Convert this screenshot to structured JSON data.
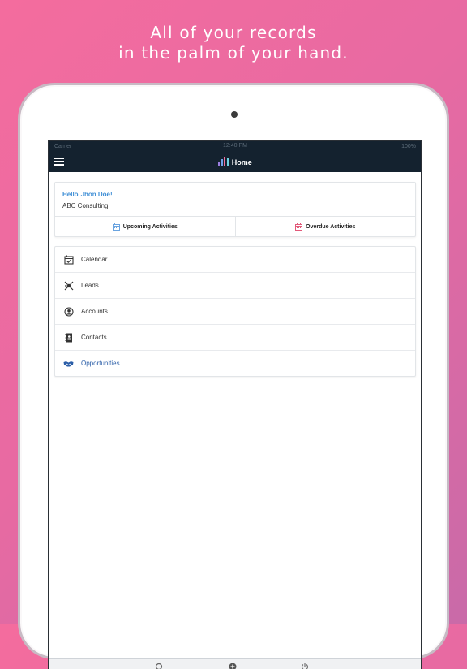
{
  "promo": {
    "line1": "All of your records",
    "line2": "in the palm of your hand."
  },
  "statusbar": {
    "carrier": "Carrier",
    "time": "12:40 PM",
    "battery": "100%"
  },
  "navbar": {
    "title": "Home",
    "menu_icon": "hamburger-icon",
    "logo_colors": [
      "#9b7fe0",
      "#6fa2e8",
      "#f06fa0",
      "#6fd0e0"
    ]
  },
  "welcome": {
    "hello": "Hello",
    "name": "Jhon Doe!",
    "company": "ABC Consulting",
    "accent": "#3f8fd6"
  },
  "activities": [
    {
      "label": "Upcoming Activities",
      "icon": "calendar-icon",
      "color": "#6aa4e0"
    },
    {
      "label": "Overdue Activities",
      "icon": "calendar-icon",
      "color": "#e25a7a"
    }
  ],
  "menu": {
    "items": [
      {
        "label": "Calendar",
        "icon": "calendar-check-icon"
      },
      {
        "label": "Leads",
        "icon": "leads-icon"
      },
      {
        "label": "Accounts",
        "icon": "account-circle-icon"
      },
      {
        "label": "Contacts",
        "icon": "contacts-book-icon"
      },
      {
        "label": "Opportunities",
        "icon": "handshake-icon",
        "active": true
      }
    ],
    "active_color": "#2b5ea8"
  }
}
